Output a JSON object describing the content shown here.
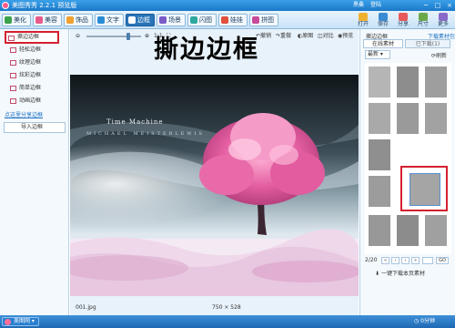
{
  "window": {
    "title": "美图秀秀 2.2.1 预览版",
    "user_items": [
      "黑桑",
      "登陆"
    ],
    "controls": [
      "─",
      "□",
      "×"
    ]
  },
  "toolbar": {
    "tabs": [
      {
        "label": "美化",
        "color": "#3aa04a",
        "active": false
      },
      {
        "label": "美容",
        "color": "#e85a8a",
        "active": false
      },
      {
        "label": "饰品",
        "color": "#f0a030",
        "active": false
      },
      {
        "label": "文字",
        "color": "#2a8ad4",
        "active": false
      },
      {
        "label": "边框",
        "color": "#ffffff",
        "active": true
      },
      {
        "label": "场景",
        "color": "#7a5ac8",
        "active": false
      },
      {
        "label": "闪图",
        "color": "#30a8a0",
        "active": false
      },
      {
        "label": "娃娃",
        "color": "#e0503a",
        "active": false
      },
      {
        "label": "拼图",
        "color": "#c84a9a",
        "active": false
      }
    ],
    "actions": [
      {
        "label": "打开",
        "color": "#f0b030"
      },
      {
        "label": "保存",
        "color": "#3a8ad4"
      },
      {
        "label": "分享",
        "color": "#e85a5a"
      },
      {
        "label": "尺寸",
        "color": "#6aa84a"
      },
      {
        "label": "更多",
        "color": "#8a6ac8"
      }
    ]
  },
  "left_panel": {
    "items": [
      {
        "label": "撕边边框",
        "selected": true
      },
      {
        "label": "轻松边框",
        "selected": false
      },
      {
        "label": "纹理边框",
        "selected": false
      },
      {
        "label": "炫彩边框",
        "selected": false
      },
      {
        "label": "简单边框",
        "selected": false
      },
      {
        "label": "动画边框",
        "selected": false
      }
    ],
    "more_link": "点这里分享边框",
    "import_label": "导入边框"
  },
  "canvas": {
    "zoom_label": "1:1",
    "tools": [
      "撤销",
      "重做",
      "原图",
      "对比",
      "预览"
    ],
    "title_text": "撕边边框",
    "photo_caption": "Time Machine",
    "photo_subcaption": "MICHAEL MEISTERLEWIS",
    "filename": "001.jpg",
    "dimensions": "750 × 528"
  },
  "right_panel": {
    "title": "撕边边框",
    "download_link": "下载素材包",
    "tabs": [
      "在线素材",
      "已下载(1)"
    ],
    "sort_value": "最新",
    "refresh_label": "刷新",
    "page_indicator": "2/20",
    "page_go": "GO",
    "download_page_label": "一键下载本页素材"
  },
  "taskbar": {
    "start_label": "美图网",
    "tray_label": "0分钟"
  }
}
